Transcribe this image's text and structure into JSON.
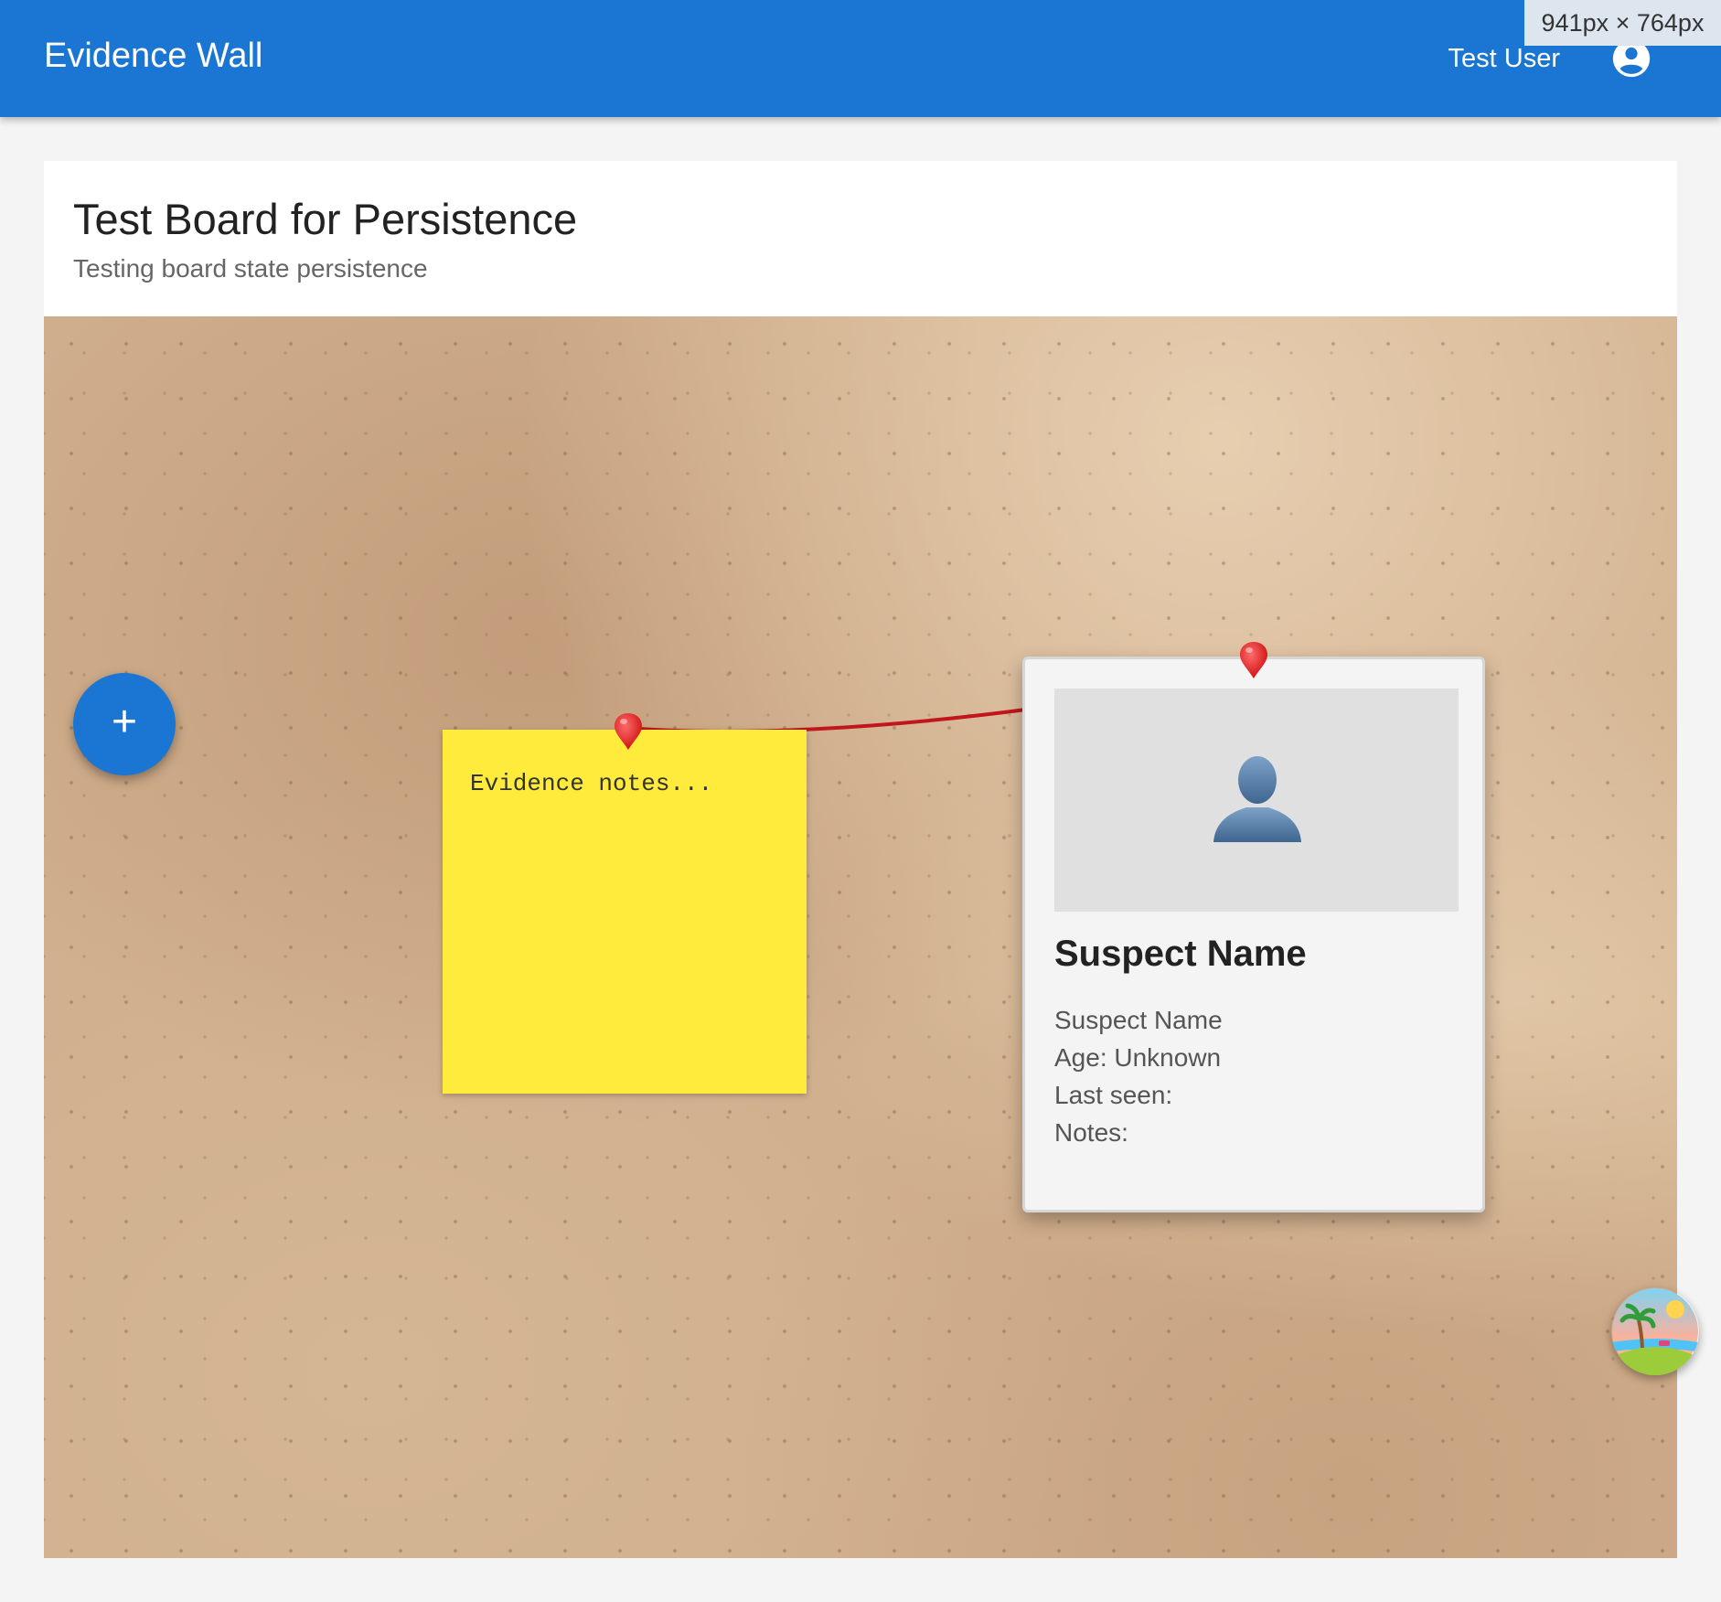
{
  "app": {
    "title": "Evidence Wall",
    "user_name": "Test User",
    "viewport_label": "941px × 764px"
  },
  "board": {
    "title": "Test Board for Persistence",
    "description": "Testing board state persistence"
  },
  "fab": {
    "label": "+"
  },
  "sticky_note": {
    "text": "Evidence notes..."
  },
  "suspect_card": {
    "title": "Suspect Name",
    "name_line": "Suspect Name",
    "age_line": "Age: Unknown",
    "last_seen_line": "Last seen:",
    "notes_line": "Notes:"
  },
  "icons": {
    "account": "account-circle-icon",
    "person": "person-silhouette-icon",
    "pin": "push-pin-icon",
    "beach": "beach-island-icon"
  },
  "colors": {
    "primary": "#1b76d3",
    "sticky": "#ffeb3b",
    "pin": "#e53935",
    "string": "#c0161c",
    "cork": "#cfae8c"
  }
}
